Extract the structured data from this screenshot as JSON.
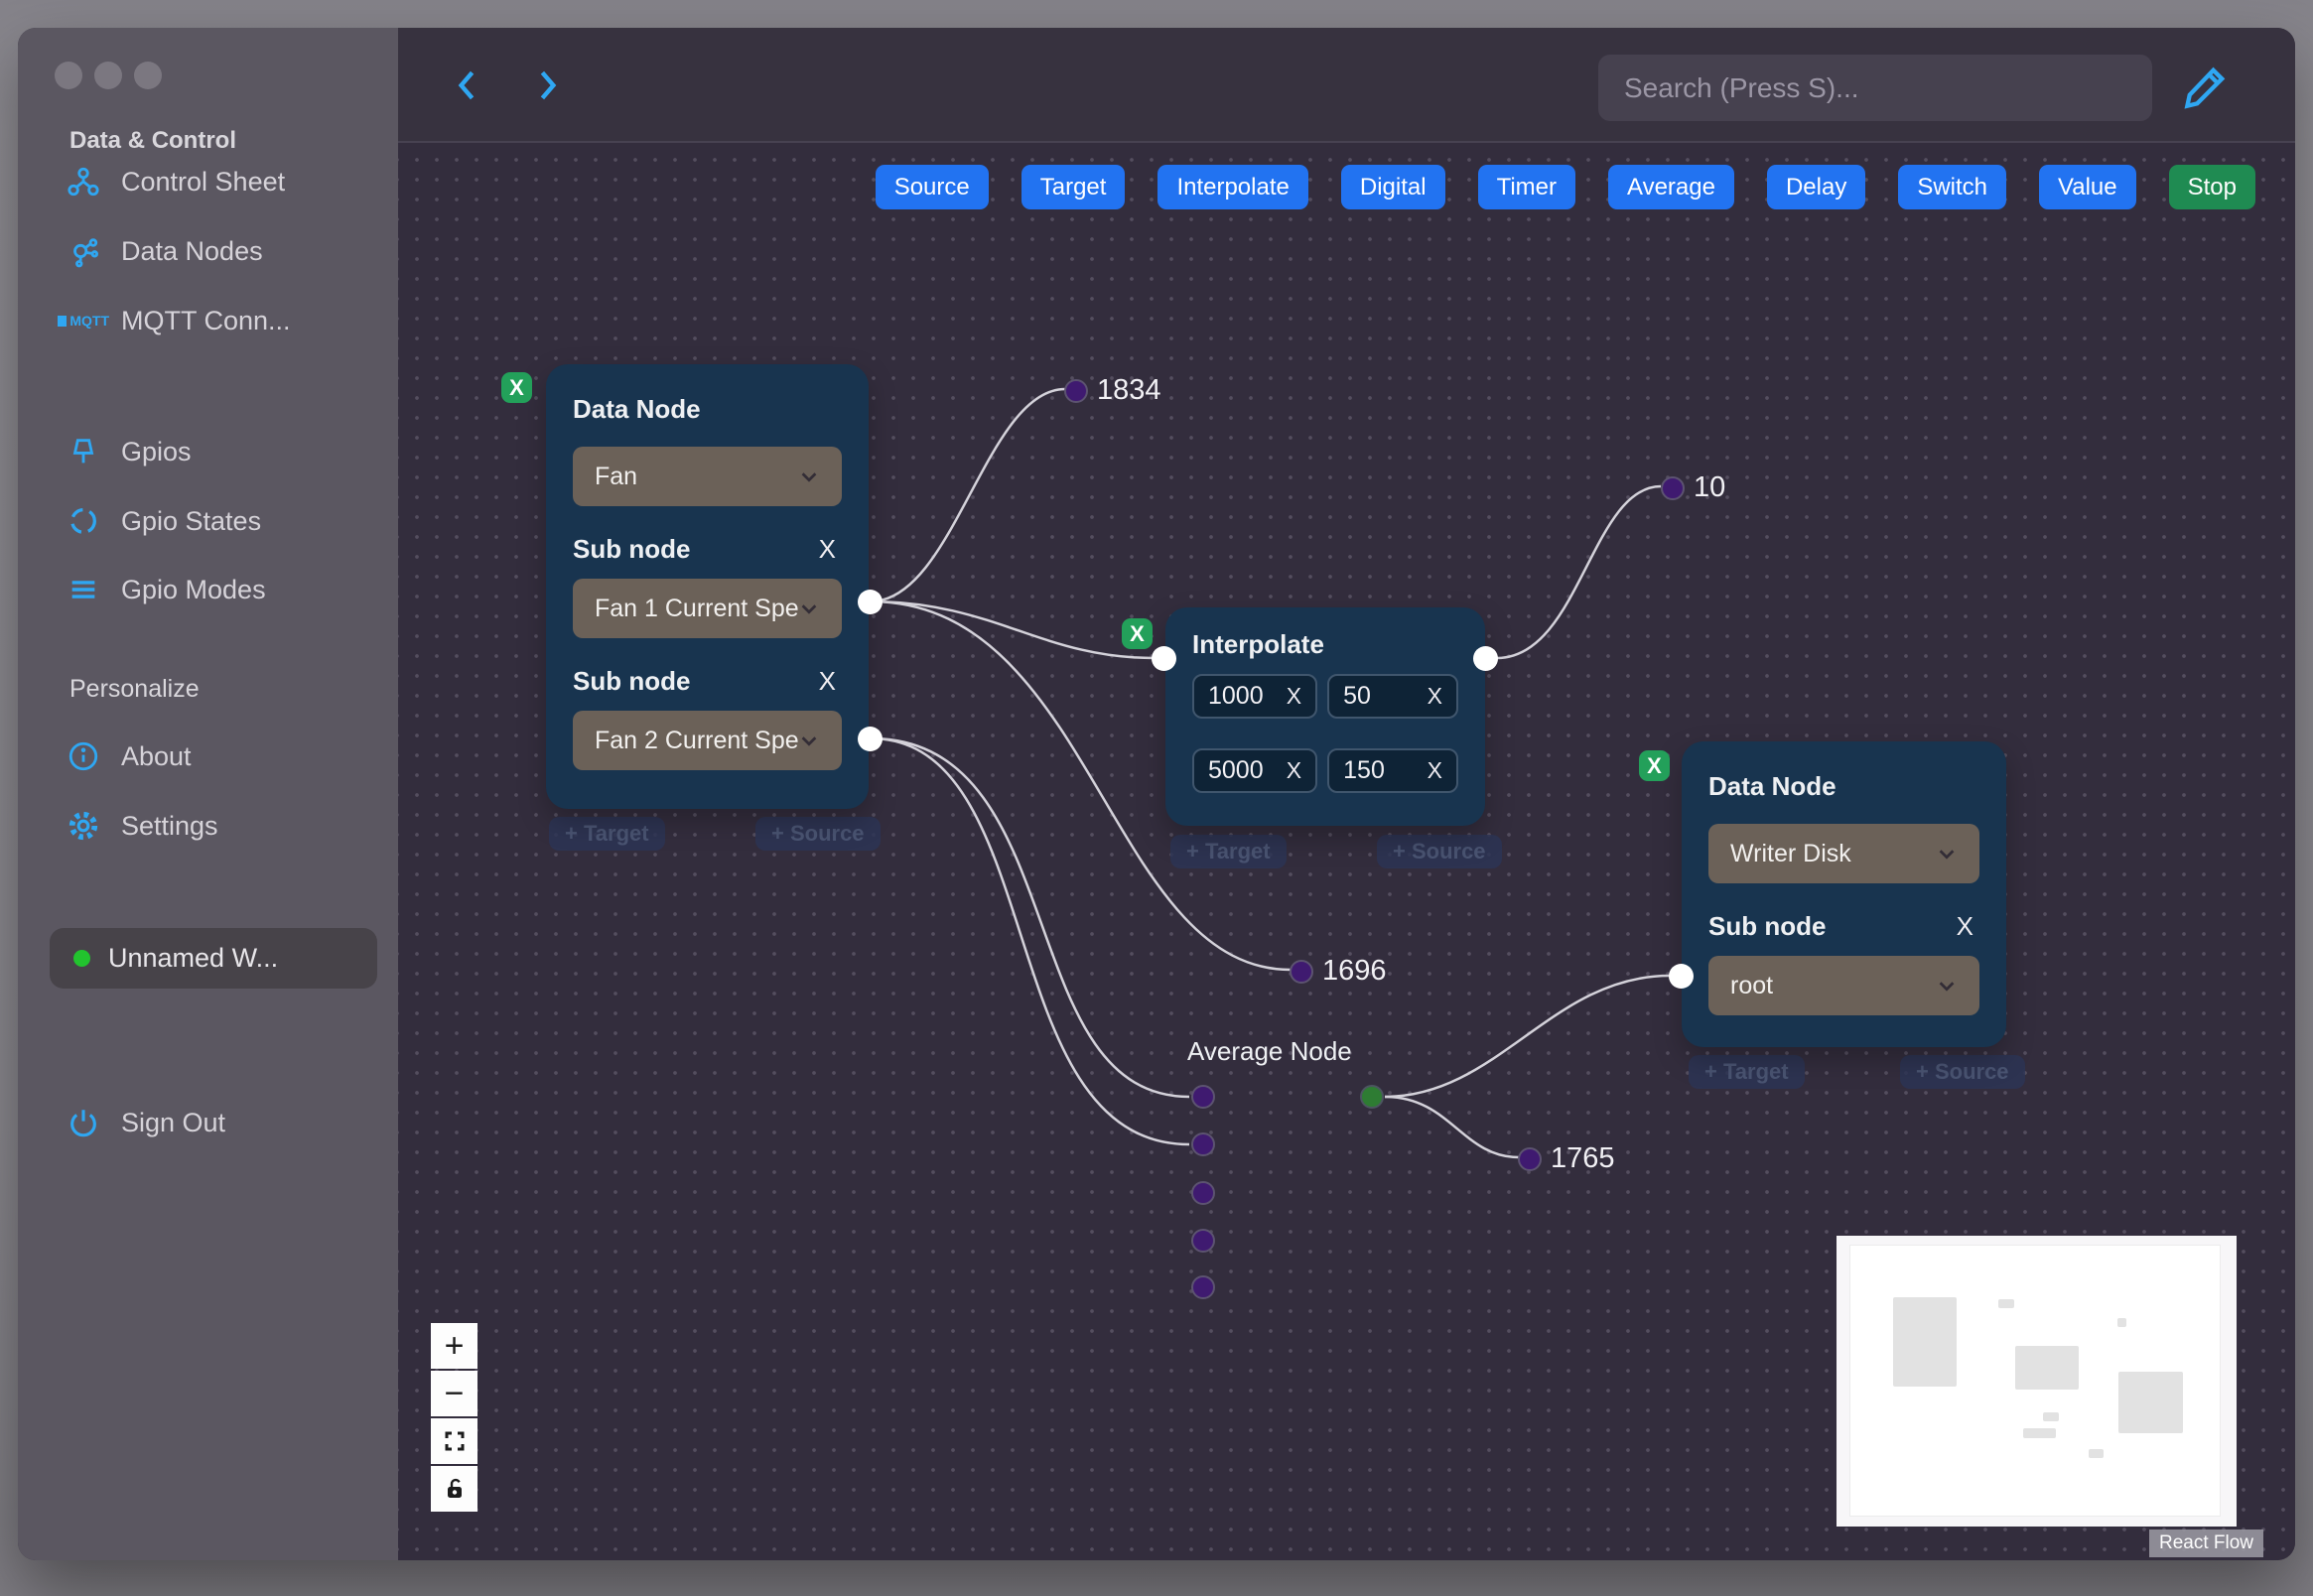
{
  "theme": {
    "accent-blue": "#2273f1",
    "accent-green": "#1f8b52",
    "icon-blue": "#2fa7f2",
    "node-bg": "#18344f",
    "select-bg": "#6b6158",
    "canvas-bg": "#332d3d",
    "sidebar-bg": "#5b5761",
    "edge-color": "#d4d2da",
    "handle-purple": "#3f1a70",
    "handle-green": "#2e7c33",
    "badge-green": "#23a05a",
    "status-green": "#22c32e"
  },
  "sidebar": {
    "section1": "Data & Control",
    "item_control_sheet": "Control Sheet",
    "item_data_nodes": "Data Nodes",
    "item_mqtt": "MQTT Conn...",
    "mqtt_icon_text": "MQTT",
    "item_gpios": "Gpios",
    "item_gpio_states": "Gpio States",
    "item_gpio_modes": "Gpio Modes",
    "section2": "Personalize",
    "item_about": "About",
    "item_settings": "Settings",
    "workspace_label": "Unnamed W...",
    "item_sign_out": "Sign Out"
  },
  "header": {
    "search_placeholder": "Search (Press S)..."
  },
  "toolbar": {
    "buttons": [
      "Source",
      "Target",
      "Interpolate",
      "Digital",
      "Timer",
      "Average",
      "Delay",
      "Switch",
      "Value",
      "Stop"
    ]
  },
  "nodes": {
    "fan": {
      "title": "Data Node",
      "value": "Fan",
      "sub1_label": "Sub node",
      "sub1_value": "Fan 1 Current Spe",
      "sub2_label": "Sub node",
      "sub2_value": "Fan 2 Current Spe",
      "remove": "X",
      "sub_remove": "X",
      "add_target": "+ Target",
      "add_source": "+ Source"
    },
    "interpolate": {
      "title": "Interpolate",
      "remove": "X",
      "v00": "1000",
      "v01": "50",
      "v10": "5000",
      "v11": "150",
      "clear": "X",
      "add_target": "+ Target",
      "add_source": "+ Source"
    },
    "writer": {
      "title": "Data Node",
      "value": "Writer Disk",
      "sub_label": "Sub node",
      "sub_value": "root",
      "remove": "X",
      "sub_remove": "X",
      "add_target": "+ Target",
      "add_source": "+ Source"
    },
    "average": {
      "title": "Average Node"
    }
  },
  "canvas": {
    "labels": {
      "l1834": "1834",
      "l10": "10",
      "l1696": "1696",
      "l1765": "1765"
    },
    "attribution": "React Flow"
  }
}
